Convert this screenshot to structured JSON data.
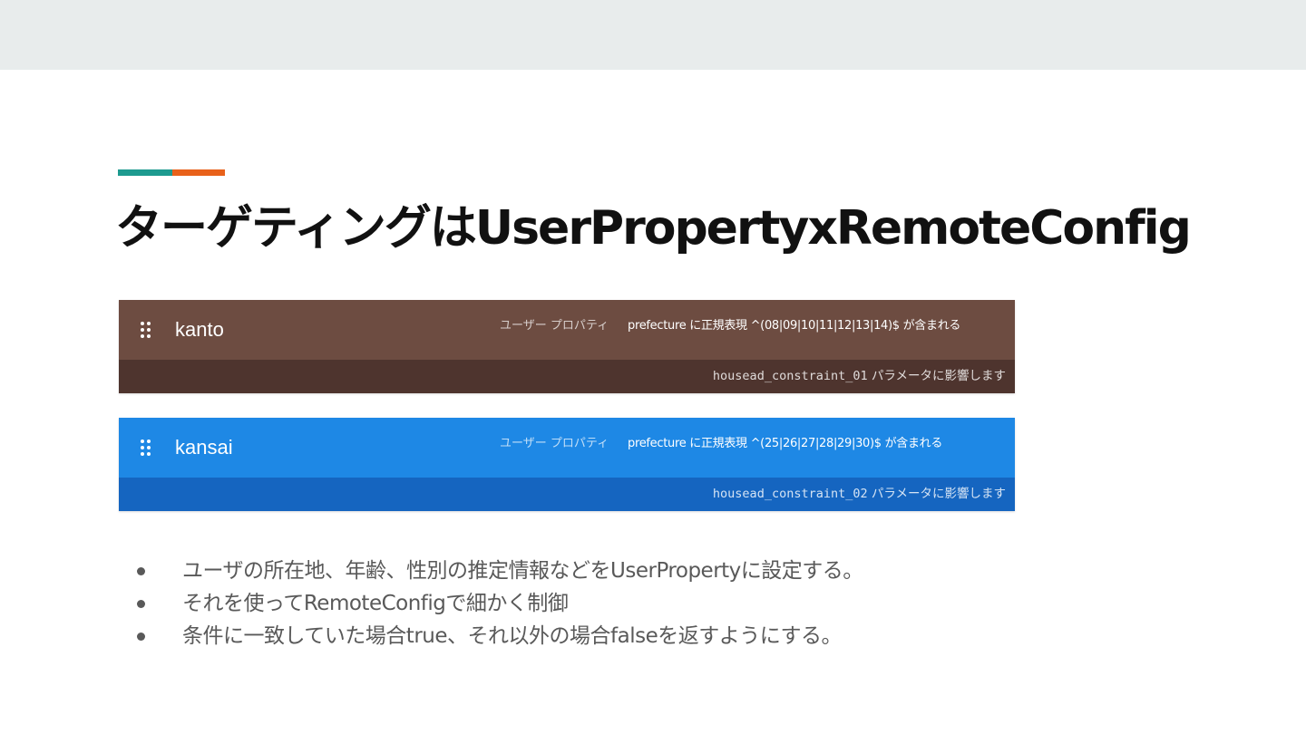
{
  "slide": {
    "title": "ターゲティングはUserPropertyxRemoteConfig",
    "colors": {
      "accent_teal": "#1d9a8f",
      "accent_orange": "#e8611a",
      "header_bg": "#e8ecec"
    }
  },
  "conditions": [
    {
      "name": "kanto",
      "property_label": "ユーザー プロパティ",
      "rule": "prefecture に正規表現 ^(08|09|10|11|12|13|14)$ が含まれる",
      "parameter_key": "housead_constraint_01",
      "parameter_note": " パラメータに影響します",
      "icon": "drag-handle-icon",
      "colors": {
        "upper": "#6d4c41",
        "lower": "#4e342e"
      }
    },
    {
      "name": "kansai",
      "property_label": "ユーザー プロパティ",
      "rule": "prefecture に正規表現 ^(25|26|27|28|29|30)$ が含まれる",
      "parameter_key": "housead_constraint_02",
      "parameter_note": " パラメータに影響します",
      "icon": "drag-handle-icon",
      "colors": {
        "upper": "#1e88e5",
        "lower": "#1565c0"
      }
    }
  ],
  "bullets": [
    "ユーザの所在地、年齢、性別の推定情報などをUserPropertyに設定する。",
    "それを使ってRemoteConfigで細かく制御",
    "条件に一致していた場合true、それ以外の場合falseを返すようにする。"
  ]
}
